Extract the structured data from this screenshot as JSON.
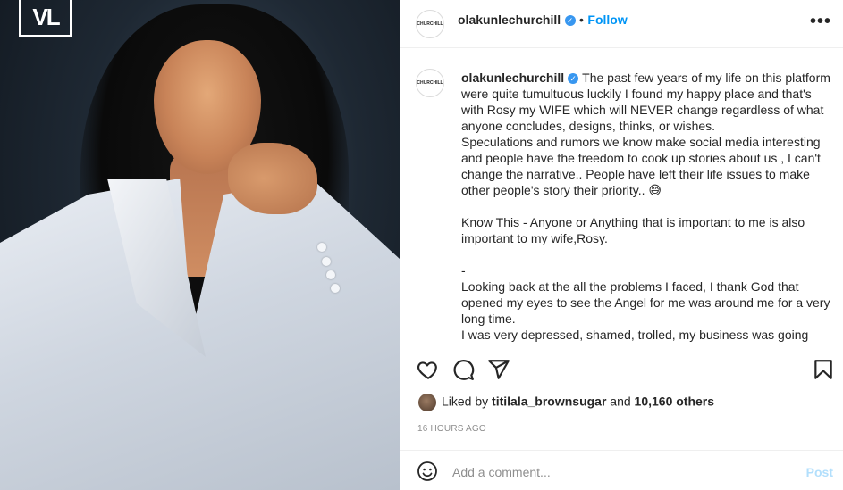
{
  "photo": {
    "logo_text": "VL"
  },
  "post": {
    "username": "olakunlechurchill",
    "separator": "•",
    "follow_label": "Follow",
    "more_label": "•••",
    "avatar_text": "CHURCHILL",
    "caption": "The past few years of my life on this platform were quite tumultuous luckily I found my happy place and that's with Rosy my WIFE which will NEVER change regardless of what anyone concludes, designs, thinks, or wishes.\nSpeculations and rumors we know make social media interesting and people have the freedom to cook up stories about us , I can't change the narrative.. People have left their life issues to make other people's story their priority.. 😅\n\nKnow This - Anyone or Anything that is important to me is also important to my wife,Rosy.\n\n-\nLooking back at the all the problems I faced, I thank God that opened my eyes to see the Angel for me was around me for a very long time.\nI was very depressed, shamed, trolled, my business was going down"
  },
  "likes": {
    "prefix": "Liked by",
    "liker": "titilala_brownsugar",
    "conjunction": "and",
    "others": "10,160 others"
  },
  "timestamp": "16 HOURS AGO",
  "comment_box": {
    "placeholder": "Add a comment...",
    "post_label": "Post"
  },
  "colors": {
    "accent": "#0095f6",
    "verified": "#3897f0",
    "post_disabled": "#b2dffc",
    "muted": "#8e8e8e"
  },
  "icons": [
    "heart-icon",
    "comment-icon",
    "share-icon",
    "bookmark-icon",
    "emoji-icon",
    "verified-icon",
    "more-icon"
  ]
}
